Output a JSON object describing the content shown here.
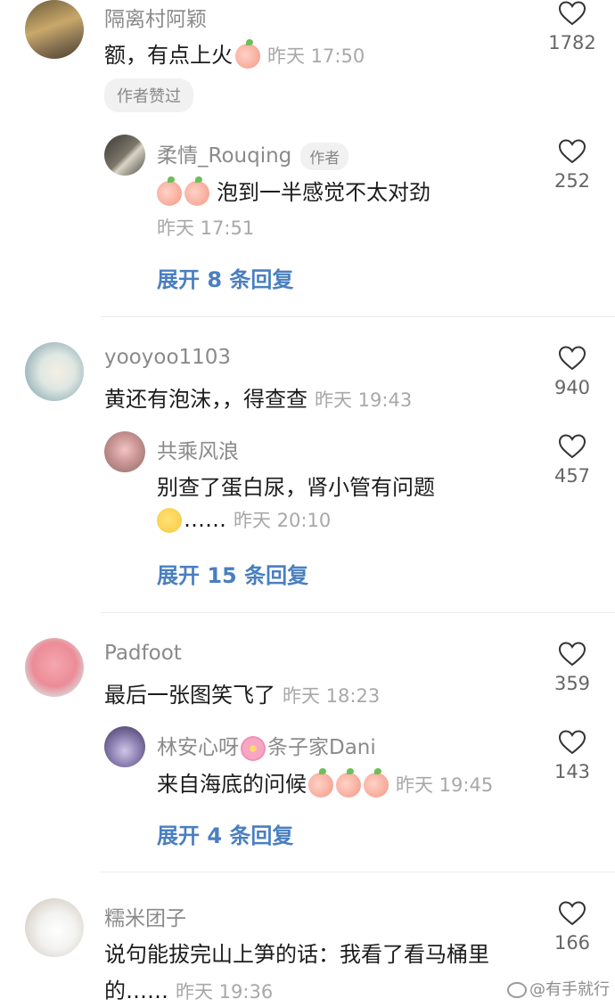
{
  "comments": [
    {
      "user": "隔离村阿颖",
      "text": "额，有点上火",
      "time": "昨天 17:50",
      "likes": "1782",
      "badge": "作者赞过",
      "reply": {
        "user": "柔情_Rouqing",
        "author_tag": "作者",
        "text": "泡到一半感觉不太对劲",
        "time": "昨天 17:51",
        "likes": "252"
      },
      "expand": "展开 8 条回复"
    },
    {
      "user": "yooyoo1103",
      "text": "黄还有泡沫，，得查查",
      "time": "昨天 19:43",
      "likes": "940",
      "reply": {
        "user": "共乘风浪",
        "text_line1": "别查了蛋白尿，肾小管有问题",
        "text_line2": "……",
        "time": "昨天 20:10",
        "likes": "457"
      },
      "expand": "展开 15 条回复"
    },
    {
      "user": "Padfoot",
      "text": "最后一张图笑飞了",
      "time": "昨天 18:23",
      "likes": "359",
      "reply": {
        "user_part1": "林安心呀",
        "user_part2": "条子家Dani",
        "text": "来自海底的问候",
        "time": "昨天 19:45",
        "likes": "143"
      },
      "expand": "展开 4 条回复"
    },
    {
      "user": "糯米团子",
      "text_line1": "说句能拔完山上笋的话：我看了看马桶里",
      "text_line2": "的……",
      "time": "昨天 19:36",
      "likes": "166"
    }
  ],
  "watermark": "@有手就行",
  "colors": {
    "link": "#4a7fc0",
    "meta": "#a8a8a8",
    "name": "#8a8a8a"
  }
}
